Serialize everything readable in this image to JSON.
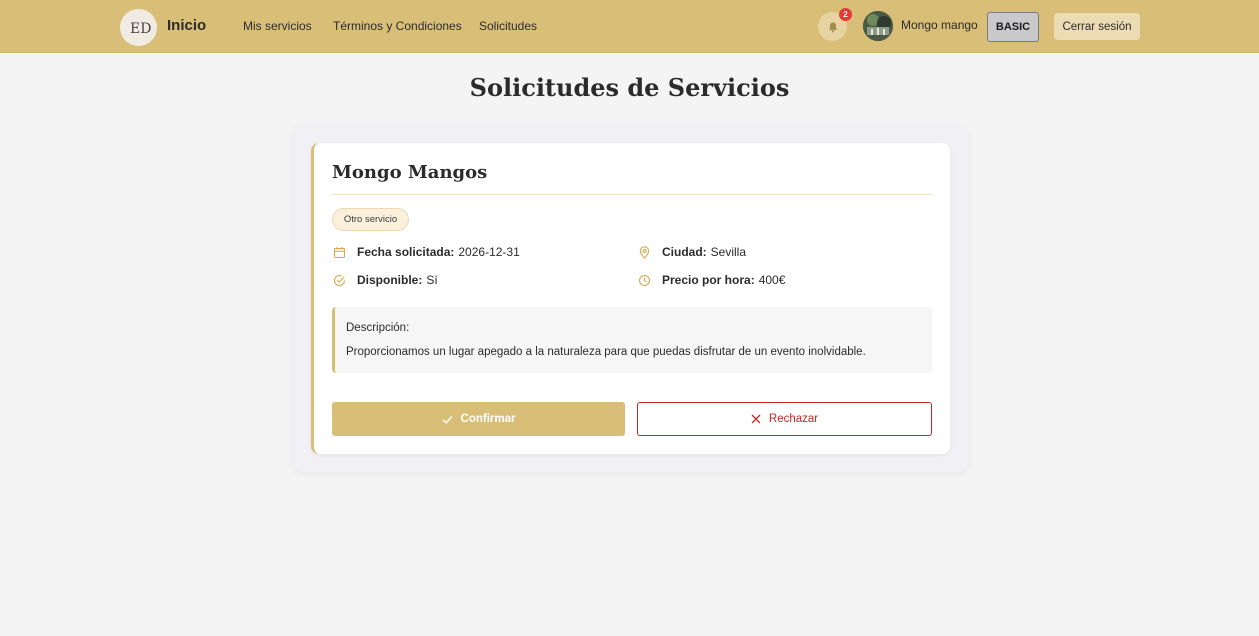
{
  "header": {
    "brand": "Inicio",
    "logo_text": "ED",
    "nav": [
      "Mis servicios",
      "Términos y Condiciones",
      "Solicitudes"
    ],
    "notification_count": "2",
    "username": "Mongo mango",
    "plan": "BASIC",
    "logout": "Cerrar sesión"
  },
  "page": {
    "title": "Solicitudes de Servicios"
  },
  "request": {
    "name": "Mongo Mangos",
    "tag": "Otro servicio",
    "fecha_label": "Fecha solicitada:",
    "fecha_value": "2026-12-31",
    "ciudad_label": "Ciudad:",
    "ciudad_value": "Sevilla",
    "disponible_label": "Disponible:",
    "disponible_value": "Sí",
    "precio_label": "Precio por hora:",
    "precio_value": "400€",
    "desc_label": "Descripción:",
    "desc_text": "Proporcionamos un lugar apegado a la naturaleza para que puedas disfrutar de un evento inolvidable.",
    "confirm": "Confirmar",
    "reject": "Rechazar"
  },
  "colors": {
    "accent": "#d9be78",
    "danger": "#c62828",
    "background": "#f4f4f4"
  }
}
